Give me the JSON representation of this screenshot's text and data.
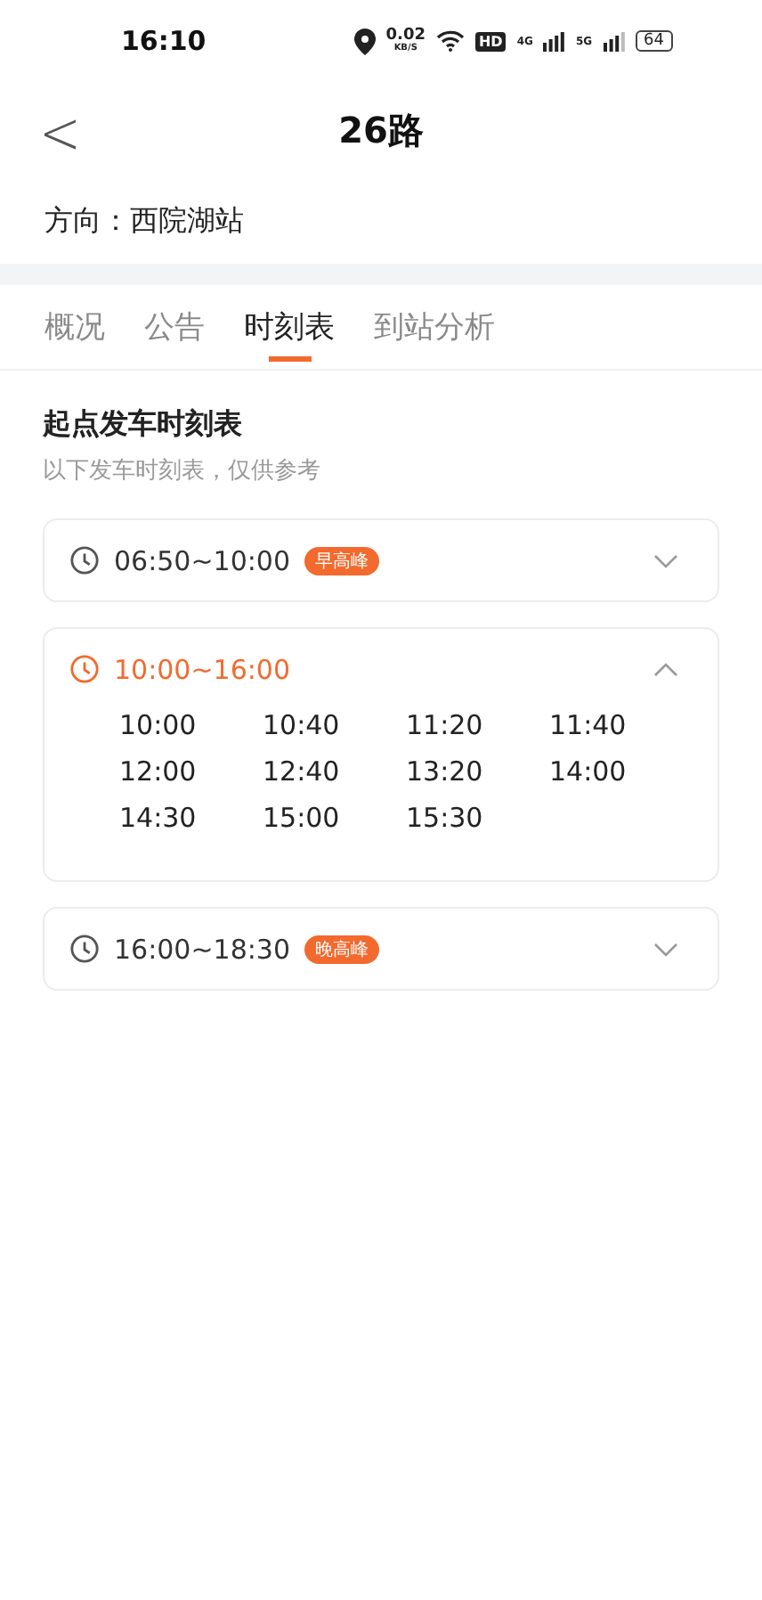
{
  "status_bar": {
    "time": "16:10",
    "speed": "0.02",
    "speed_unit": "KB/S",
    "hd": "HD",
    "net1": "4G",
    "net2": "5G",
    "battery": "64"
  },
  "header": {
    "back": "<",
    "title": "26路"
  },
  "direction": "方向：西院湖站",
  "tabs": [
    {
      "label": "概况",
      "selected": false
    },
    {
      "label": "公告",
      "selected": false
    },
    {
      "label": "时刻表",
      "selected": true
    },
    {
      "label": "到站分析",
      "selected": false
    }
  ],
  "section": {
    "title": "起点发车时刻表",
    "subtitle": "以下发车时刻表，仅供参考"
  },
  "periods": [
    {
      "range": "06:50~10:00",
      "badge": "早高峰",
      "expanded": false
    },
    {
      "range": "10:00~16:00",
      "expanded": true,
      "times": [
        "10:00",
        "10:40",
        "11:20",
        "11:40",
        "12:00",
        "12:40",
        "13:20",
        "14:00",
        "14:30",
        "15:00",
        "15:30"
      ]
    },
    {
      "range": "16:00~18:30",
      "badge": "晚高峰",
      "expanded": false
    }
  ]
}
